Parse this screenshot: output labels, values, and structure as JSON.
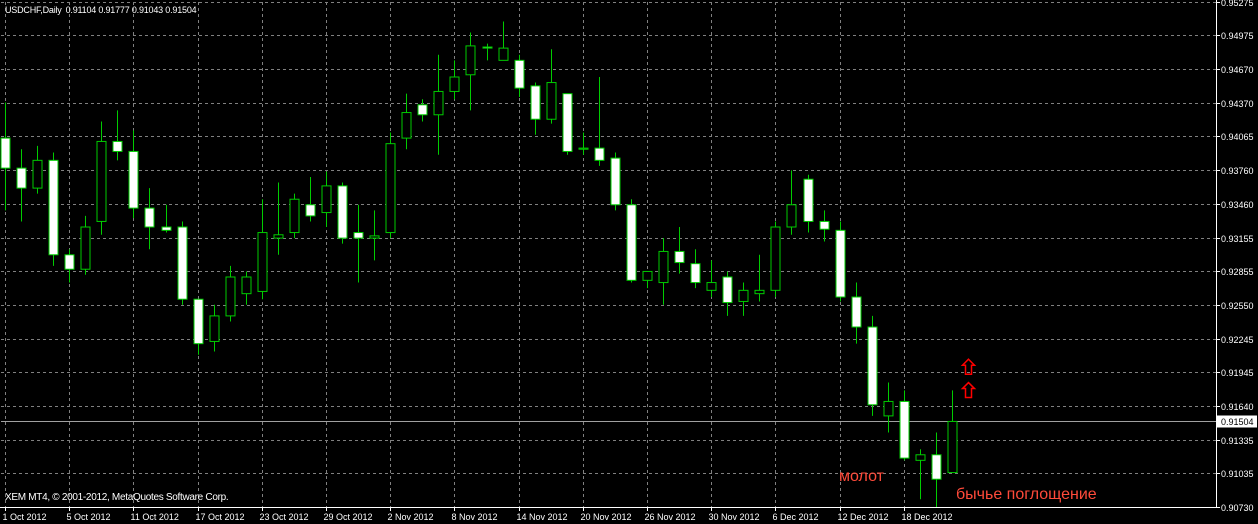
{
  "header": {
    "symbol": "USDCHF,Daily",
    "open": "0.91104",
    "high": "0.91777",
    "low": "0.91043",
    "close": "0.91504"
  },
  "footer": {
    "copyright": "XEM MT4, © 2001-2012, MetaQuotes Software Corp."
  },
  "annotations": {
    "hammer": "молот",
    "engulfing": "бычье поглощение"
  },
  "colors": {
    "background": "#000000",
    "grid": "#808080",
    "candle_outline": "#00cc00",
    "bull_body": "#000000",
    "bear_body": "#ffffff",
    "axis_text": "#ffffff",
    "price_line": "#a0a0a0",
    "annotation": "#ff4a3a",
    "arrow": "#ff0000"
  },
  "chart_data": {
    "type": "candlestick",
    "price_axis": {
      "min": 0.9073,
      "max": 0.95275,
      "ticks": [
        "0.95275",
        "0.94975",
        "0.94670",
        "0.94370",
        "0.94065",
        "0.93760",
        "0.93460",
        "0.93155",
        "0.92855",
        "0.92550",
        "0.92245",
        "0.91945",
        "0.91640",
        "0.91335",
        "0.91035",
        "0.90730"
      ],
      "current_price": "0.91504"
    },
    "time_axis": {
      "labels": [
        "1 Oct 2012",
        "5 Oct 2012",
        "11 Oct 2012",
        "17 Oct 2012",
        "23 Oct 2012",
        "29 Oct 2012",
        "2 Nov 2012",
        "8 Nov 2012",
        "14 Nov 2012",
        "20 Nov 2012",
        "26 Nov 2012",
        "30 Nov 2012",
        "6 Dec 2012",
        "12 Dec 2012",
        "18 Dec 2012"
      ],
      "label_every_n_bars": 4
    },
    "grid": true,
    "candles": [
      {
        "o": 0.9405,
        "h": 0.9437,
        "l": 0.934,
        "c": 0.9378
      },
      {
        "o": 0.9378,
        "h": 0.9395,
        "l": 0.933,
        "c": 0.936
      },
      {
        "o": 0.936,
        "h": 0.9398,
        "l": 0.9355,
        "c": 0.9385
      },
      {
        "o": 0.9385,
        "h": 0.9392,
        "l": 0.929,
        "c": 0.93
      },
      {
        "o": 0.93,
        "h": 0.9305,
        "l": 0.9275,
        "c": 0.9287
      },
      {
        "o": 0.9287,
        "h": 0.9335,
        "l": 0.9282,
        "c": 0.9325
      },
      {
        "o": 0.933,
        "h": 0.942,
        "l": 0.9318,
        "c": 0.9402
      },
      {
        "o": 0.9402,
        "h": 0.943,
        "l": 0.9385,
        "c": 0.9393
      },
      {
        "o": 0.9393,
        "h": 0.9412,
        "l": 0.9333,
        "c": 0.9342
      },
      {
        "o": 0.9342,
        "h": 0.936,
        "l": 0.9305,
        "c": 0.9325
      },
      {
        "o": 0.9325,
        "h": 0.9345,
        "l": 0.932,
        "c": 0.9322
      },
      {
        "o": 0.9325,
        "h": 0.933,
        "l": 0.9255,
        "c": 0.926
      },
      {
        "o": 0.926,
        "h": 0.926,
        "l": 0.921,
        "c": 0.922
      },
      {
        "o": 0.9222,
        "h": 0.9255,
        "l": 0.9213,
        "c": 0.9245
      },
      {
        "o": 0.9245,
        "h": 0.929,
        "l": 0.924,
        "c": 0.928
      },
      {
        "o": 0.9265,
        "h": 0.9285,
        "l": 0.9255,
        "c": 0.928
      },
      {
        "o": 0.9267,
        "h": 0.935,
        "l": 0.926,
        "c": 0.932
      },
      {
        "o": 0.9315,
        "h": 0.9365,
        "l": 0.93,
        "c": 0.9318
      },
      {
        "o": 0.932,
        "h": 0.9355,
        "l": 0.9315,
        "c": 0.935
      },
      {
        "o": 0.9345,
        "h": 0.937,
        "l": 0.933,
        "c": 0.9335
      },
      {
        "o": 0.9338,
        "h": 0.9375,
        "l": 0.9325,
        "c": 0.9362
      },
      {
        "o": 0.9362,
        "h": 0.9365,
        "l": 0.931,
        "c": 0.9315
      },
      {
        "o": 0.932,
        "h": 0.9345,
        "l": 0.9275,
        "c": 0.9315
      },
      {
        "o": 0.9315,
        "h": 0.934,
        "l": 0.9295,
        "c": 0.9317
      },
      {
        "o": 0.932,
        "h": 0.941,
        "l": 0.9315,
        "c": 0.94
      },
      {
        "o": 0.9405,
        "h": 0.9445,
        "l": 0.9395,
        "c": 0.9428
      },
      {
        "o": 0.9435,
        "h": 0.944,
        "l": 0.942,
        "c": 0.9426
      },
      {
        "o": 0.9426,
        "h": 0.948,
        "l": 0.939,
        "c": 0.9447
      },
      {
        "o": 0.9447,
        "h": 0.9475,
        "l": 0.944,
        "c": 0.946
      },
      {
        "o": 0.9462,
        "h": 0.95,
        "l": 0.943,
        "c": 0.9488
      },
      {
        "o": 0.9487,
        "h": 0.949,
        "l": 0.9475,
        "c": 0.9486
      },
      {
        "o": 0.9475,
        "h": 0.951,
        "l": 0.9475,
        "c": 0.9486
      },
      {
        "o": 0.9475,
        "h": 0.948,
        "l": 0.9442,
        "c": 0.945
      },
      {
        "o": 0.9452,
        "h": 0.9455,
        "l": 0.9408,
        "c": 0.9422
      },
      {
        "o": 0.9422,
        "h": 0.9485,
        "l": 0.9418,
        "c": 0.9455
      },
      {
        "o": 0.9445,
        "h": 0.9445,
        "l": 0.939,
        "c": 0.9393
      },
      {
        "o": 0.9395,
        "h": 0.941,
        "l": 0.939,
        "c": 0.9396
      },
      {
        "o": 0.9396,
        "h": 0.946,
        "l": 0.938,
        "c": 0.9385
      },
      {
        "o": 0.9387,
        "h": 0.9392,
        "l": 0.934,
        "c": 0.9345
      },
      {
        "o": 0.9345,
        "h": 0.935,
        "l": 0.9275,
        "c": 0.9277
      },
      {
        "o": 0.9277,
        "h": 0.9285,
        "l": 0.927,
        "c": 0.9285
      },
      {
        "o": 0.9275,
        "h": 0.9315,
        "l": 0.9255,
        "c": 0.9303
      },
      {
        "o": 0.9303,
        "h": 0.9325,
        "l": 0.9283,
        "c": 0.9293
      },
      {
        "o": 0.9292,
        "h": 0.9305,
        "l": 0.927,
        "c": 0.9275
      },
      {
        "o": 0.9268,
        "h": 0.9295,
        "l": 0.9262,
        "c": 0.9275
      },
      {
        "o": 0.928,
        "h": 0.9285,
        "l": 0.9245,
        "c": 0.9257
      },
      {
        "o": 0.9258,
        "h": 0.9275,
        "l": 0.9245,
        "c": 0.9268
      },
      {
        "o": 0.9265,
        "h": 0.93,
        "l": 0.9258,
        "c": 0.9268
      },
      {
        "o": 0.9268,
        "h": 0.933,
        "l": 0.9262,
        "c": 0.9325
      },
      {
        "o": 0.9325,
        "h": 0.9376,
        "l": 0.9318,
        "c": 0.9345
      },
      {
        "o": 0.9368,
        "h": 0.9372,
        "l": 0.932,
        "c": 0.933
      },
      {
        "o": 0.933,
        "h": 0.934,
        "l": 0.9312,
        "c": 0.9323
      },
      {
        "o": 0.9322,
        "h": 0.933,
        "l": 0.9258,
        "c": 0.9262
      },
      {
        "o": 0.9262,
        "h": 0.9275,
        "l": 0.922,
        "c": 0.9235
      },
      {
        "o": 0.9235,
        "h": 0.9245,
        "l": 0.9155,
        "c": 0.9165
      },
      {
        "o": 0.9155,
        "h": 0.9185,
        "l": 0.914,
        "c": 0.9168
      },
      {
        "o": 0.9168,
        "h": 0.9178,
        "l": 0.9115,
        "c": 0.9117
      },
      {
        "o": 0.9115,
        "h": 0.9125,
        "l": 0.908,
        "c": 0.912
      },
      {
        "o": 0.912,
        "h": 0.914,
        "l": 0.9073,
        "c": 0.9098
      },
      {
        "o": 0.9104,
        "h": 0.9178,
        "l": 0.9104,
        "c": 0.915
      }
    ],
    "arrows_at_candle": 60,
    "arrow_prices": [
      0.9206,
      0.9185
    ]
  }
}
